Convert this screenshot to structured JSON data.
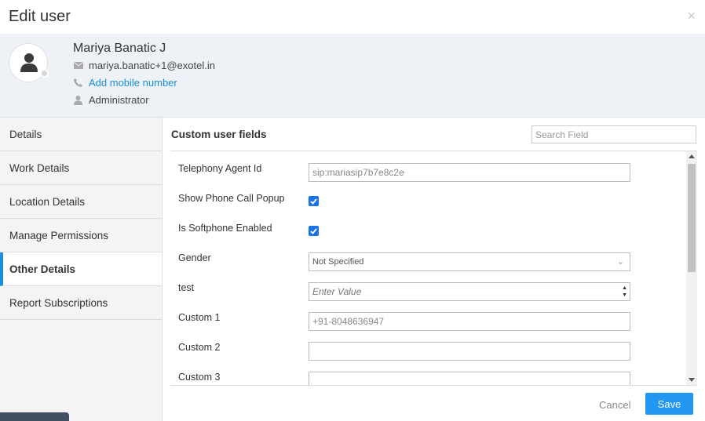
{
  "dialog": {
    "title": "Edit user",
    "close_glyph": "×"
  },
  "profile": {
    "name": "Mariya Banatic J",
    "email": "mariya.banatic+1@exotel.in",
    "phone_link": "Add mobile number",
    "role": "Administrator",
    "icons": [
      "user-avatar-icon",
      "envelope-icon",
      "phone-icon",
      "person-icon"
    ]
  },
  "sidebar": {
    "items": [
      {
        "label": "Details",
        "active": false
      },
      {
        "label": "Work Details",
        "active": false
      },
      {
        "label": "Location Details",
        "active": false
      },
      {
        "label": "Manage Permissions",
        "active": false
      },
      {
        "label": "Other Details",
        "active": true
      },
      {
        "label": "Report Subscriptions",
        "active": false
      }
    ]
  },
  "main": {
    "section_title": "Custom user fields",
    "search_placeholder": "Search Field",
    "fields": [
      {
        "label": "Telephony Agent Id",
        "type": "text",
        "value": "sip:mariasip7b7e8c2e"
      },
      {
        "label": "Show Phone Call Popup",
        "type": "checkbox",
        "checked": true
      },
      {
        "label": "Is Softphone Enabled",
        "type": "checkbox",
        "checked": true
      },
      {
        "label": "Gender",
        "type": "select",
        "value": "Not Specified"
      },
      {
        "label": "test",
        "type": "number",
        "placeholder": "Enter Value"
      },
      {
        "label": "Custom 1",
        "type": "text",
        "value": "+91-8048636947"
      },
      {
        "label": "Custom 2",
        "type": "text",
        "value": ""
      },
      {
        "label": "Custom 3",
        "type": "text",
        "value": ""
      }
    ]
  },
  "footer": {
    "cancel_label": "Cancel",
    "save_label": "Save"
  },
  "colors": {
    "accent": "#1a8fd8",
    "save_button": "#2196f3",
    "checkbox": "#1a73e8",
    "profile_bg": "#eef1f5"
  }
}
